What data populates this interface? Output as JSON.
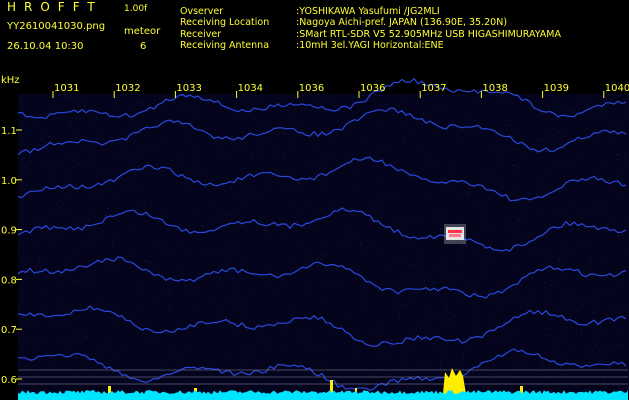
{
  "header": {
    "app_title": "HROFFT",
    "app_version": "1.00f",
    "filename": "YY2610041030.png",
    "meteor_label": "meteor",
    "datetime": "26.10.04 10:30",
    "meteor_count": "6"
  },
  "station": [
    {
      "key": "Ovserver",
      "value": ":YOSHIKAWA Yasufumi /JG2MLI"
    },
    {
      "key": "Receiving Location",
      "value": ":Nagoya Aichi-pref. JAPAN (136.90E, 35.20N)"
    },
    {
      "key": "Receiver",
      "value": ":SMart RTL-SDR V5 52.905MHz USB HIGASHIMURAYAMA"
    },
    {
      "key": "Receiving Antenna",
      "value": ":10mH 3el.YAGI Horizontal:ENE"
    }
  ],
  "axis": {
    "unit": "kHz",
    "time_ticks": [
      "1031",
      "1032",
      "1033",
      "1034",
      "1036",
      "1036",
      "1037",
      "1038",
      "1039",
      "1040"
    ],
    "freq_ticks": [
      "1.1",
      "1.0",
      "0.9",
      "0.8",
      "0.7",
      "0.6"
    ]
  },
  "colors": {
    "background": "#000000",
    "text": "#ffff33",
    "trace": "#3355ff",
    "noise_floor": "#00e5ff",
    "meteor_echo": "#ff3344",
    "signal_peak": "#ffee00"
  }
}
